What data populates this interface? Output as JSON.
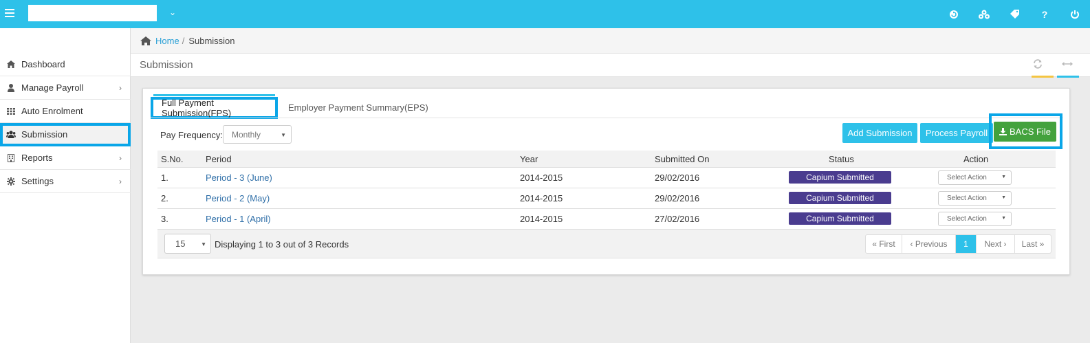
{
  "topbar": {
    "company_value": "",
    "icons": [
      "refresh-circle-icon",
      "group-icon",
      "tag-icon",
      "help-icon",
      "power-icon"
    ],
    "help_glyph": "?"
  },
  "sidebar": {
    "items": [
      {
        "label": "Dashboard",
        "icon": "home-icon"
      },
      {
        "label": "Manage Payroll",
        "icon": "user-icon",
        "has_children": true
      },
      {
        "label": "Auto Enrolment",
        "icon": "grid-icon"
      },
      {
        "label": "Submission",
        "icon": "users-icon",
        "active": true
      },
      {
        "label": "Reports",
        "icon": "report-icon",
        "has_children": true
      },
      {
        "label": "Settings",
        "icon": "gear-icon",
        "has_children": true
      }
    ]
  },
  "breadcrumb": {
    "home": "Home",
    "separator": "/",
    "current": "Submission"
  },
  "page": {
    "title": "Submission"
  },
  "tabs": [
    {
      "label": "Full Payment Submission(FPS)",
      "active": true
    },
    {
      "label": "Employer Payment Summary(EPS)",
      "active": false
    }
  ],
  "filter": {
    "label": "Pay Frequency:",
    "value": "Monthly"
  },
  "buttons": {
    "add": "Add Submission",
    "process": "Process Payroll",
    "bacs": "BACS File"
  },
  "table": {
    "headers": [
      "S.No.",
      "Period",
      "Year",
      "Submitted On",
      "Status",
      "Action"
    ],
    "rows": [
      {
        "sno": "1.",
        "period": "Period - 3 (June)",
        "year": "2014-2015",
        "submitted": "29/02/2016",
        "status": "Capium Submitted",
        "action": "Select Action"
      },
      {
        "sno": "2.",
        "period": "Period - 2 (May)",
        "year": "2014-2015",
        "submitted": "29/02/2016",
        "status": "Capium Submitted",
        "action": "Select Action"
      },
      {
        "sno": "3.",
        "period": "Period - 1 (April)",
        "year": "2014-2015",
        "submitted": "27/02/2016",
        "status": "Capium Submitted",
        "action": "Select Action"
      }
    ]
  },
  "footer": {
    "page_size": "15",
    "records_text": "Displaying 1 to 3 out of 3 Records",
    "pager": {
      "first": "« First",
      "prev": "‹ Previous",
      "current": "1",
      "next": "Next ›",
      "last": "Last »"
    }
  },
  "colors": {
    "accent": "#2ec1e9",
    "highlight": "#0aa6e8",
    "bacs": "#43a23d",
    "badge": "#4a3c8f"
  }
}
